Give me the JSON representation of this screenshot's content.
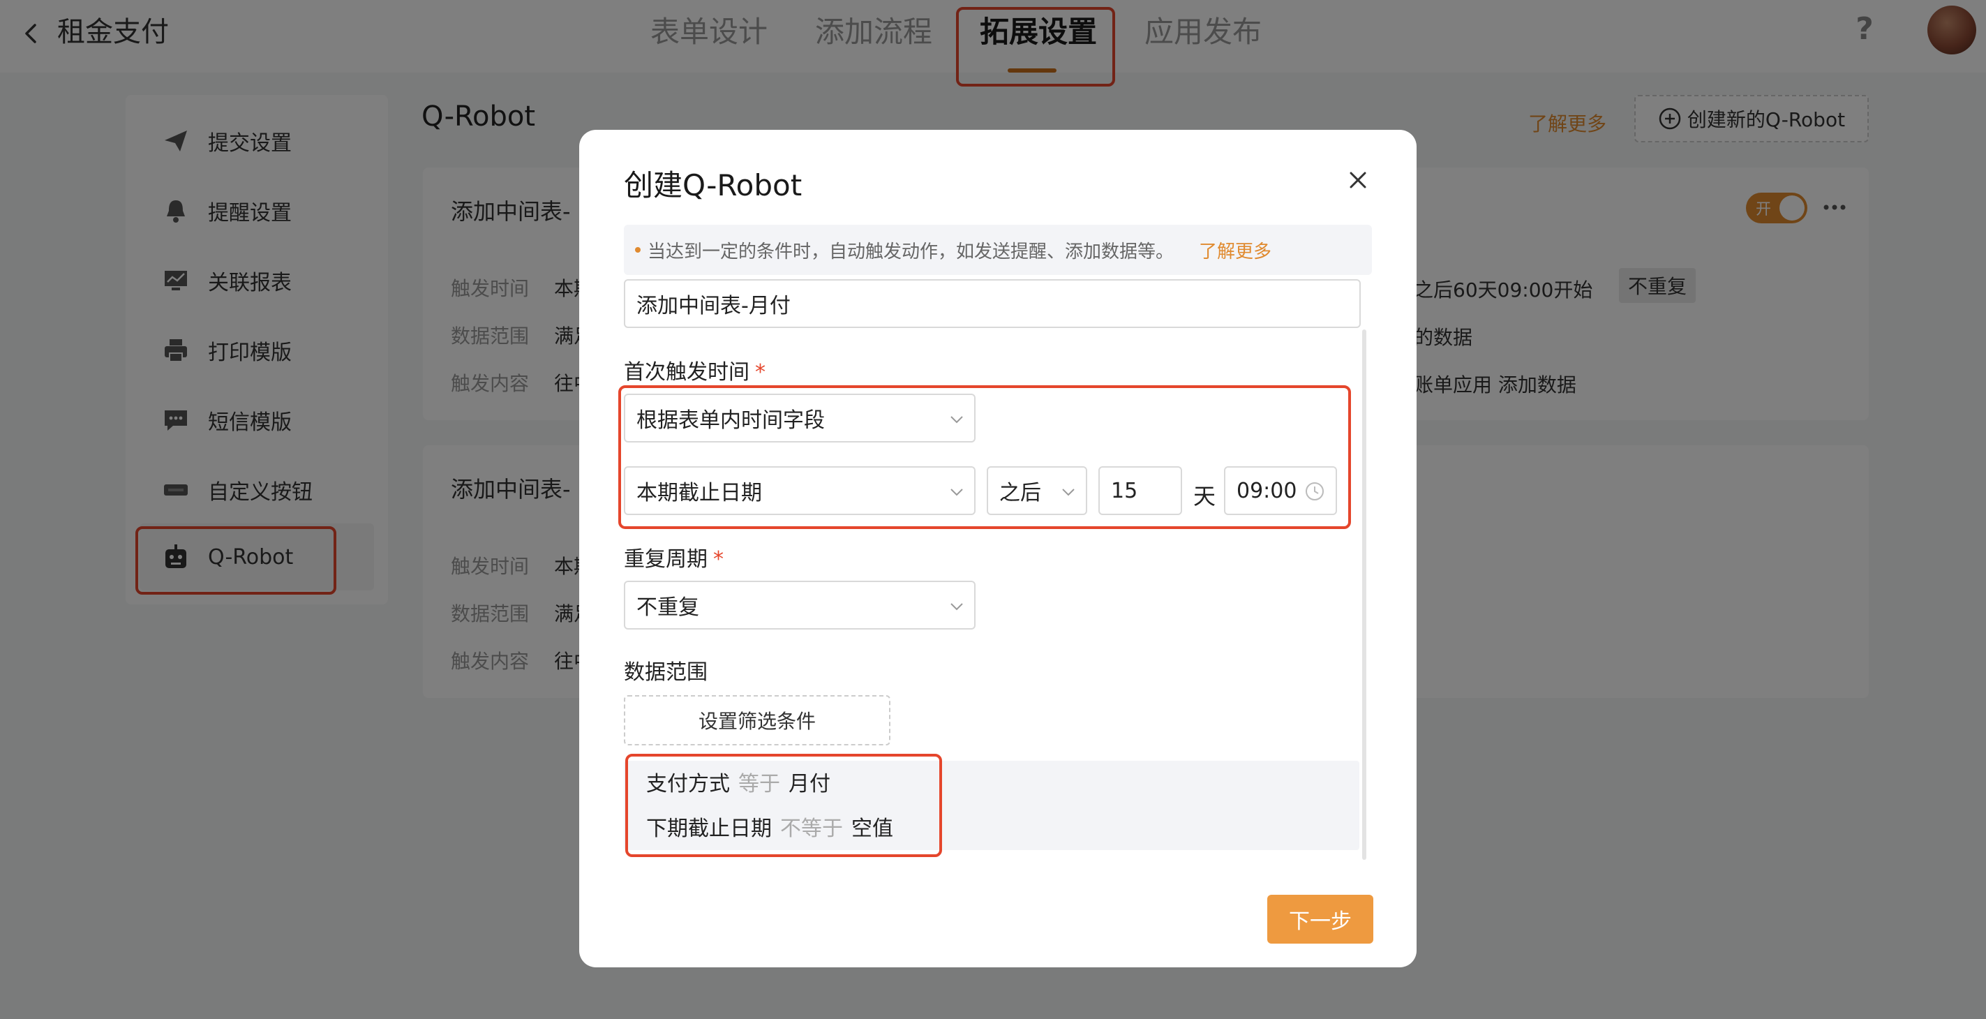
{
  "header": {
    "app_title": "租金支付",
    "tabs": [
      {
        "label": "表单设计"
      },
      {
        "label": "添加流程"
      },
      {
        "label": "拓展设置"
      },
      {
        "label": "应用发布"
      }
    ],
    "active_tab": "拓展设置"
  },
  "sidebar": {
    "items": [
      {
        "label": "提交设置",
        "icon": "send-icon"
      },
      {
        "label": "提醒设置",
        "icon": "bell-icon"
      },
      {
        "label": "关联报表",
        "icon": "report-icon"
      },
      {
        "label": "打印模版",
        "icon": "printer-icon"
      },
      {
        "label": "短信模版",
        "icon": "message-icon"
      },
      {
        "label": "自定义按钮",
        "icon": "button-icon"
      },
      {
        "label": "Q-Robot",
        "icon": "robot-icon"
      }
    ],
    "active": "Q-Robot"
  },
  "main": {
    "title": "Q-Robot",
    "learn_more": "了解更多",
    "create_button": "创建新的Q-Robot",
    "cards": [
      {
        "title": "添加中间表-",
        "rows": [
          {
            "label": "触发时间",
            "value": "本期"
          },
          {
            "label": "数据范围",
            "value": "满足"
          },
          {
            "label": "触发内容",
            "value": "往中"
          }
        ],
        "right": {
          "trigger": "之后60天09:00开始",
          "repeat_tag": "不重复",
          "scope": "的数据",
          "content": "账单应用  添加数据"
        },
        "toggle_label": "开",
        "enabled": true
      },
      {
        "title": "添加中间表-",
        "rows": [
          {
            "label": "触发时间",
            "value": "本期"
          },
          {
            "label": "数据范围",
            "value": "满足"
          },
          {
            "label": "触发内容",
            "value": "往中"
          }
        ]
      }
    ]
  },
  "modal": {
    "title": "创建Q-Robot",
    "tip": "当达到一定的条件时，自动触发动作，如发送提醒、添加数据等。",
    "tip_link": "了解更多",
    "name_value": "添加中间表-月付",
    "first_trigger": {
      "label": "首次触发时间",
      "required_mark": "*",
      "mode": "根据表单内时间字段",
      "field": "本期截止日期",
      "direction": "之后",
      "amount": "15",
      "unit": "天",
      "time": "09:00"
    },
    "repeat": {
      "label": "重复周期",
      "required_mark": "*",
      "value": "不重复"
    },
    "data_scope": {
      "label": "数据范围",
      "filter_button": "设置筛选条件",
      "conditions": [
        {
          "field": "支付方式",
          "op": "等于",
          "value": "月付"
        },
        {
          "field": "下期截止日期",
          "op": "不等于",
          "value": "空值"
        }
      ]
    },
    "next_button": "下一步"
  }
}
